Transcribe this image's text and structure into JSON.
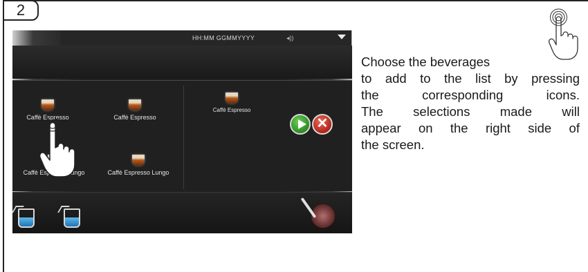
{
  "step": {
    "number": "2"
  },
  "screen": {
    "status": {
      "datetime": "HH:MM GGMMYYYY",
      "volume_glyph": "◂))"
    },
    "beverages": [
      {
        "label": "Caffè Espresso"
      },
      {
        "label": "Caffè Espresso"
      },
      {
        "label": "Caffè Espresso"
      },
      {
        "label": "Caffè Espresso Lungo"
      },
      {
        "label": "Caffè Espresso Lungo"
      }
    ],
    "confirm_glyph": "▶",
    "cancel_glyph": "✕"
  },
  "instructions": {
    "line1": "Choose the beverages",
    "line2": "to add to the list by pressing",
    "line3": "the corresponding icons.",
    "line4": "The selections made will",
    "line5": "appear on the right side of",
    "line6": "the screen."
  },
  "icons": [
    "touch-hand-icon",
    "tap-gesture-icon",
    "menu-chevron-icon",
    "volume-icon",
    "water-jug-icon",
    "steam-wand-icon"
  ]
}
